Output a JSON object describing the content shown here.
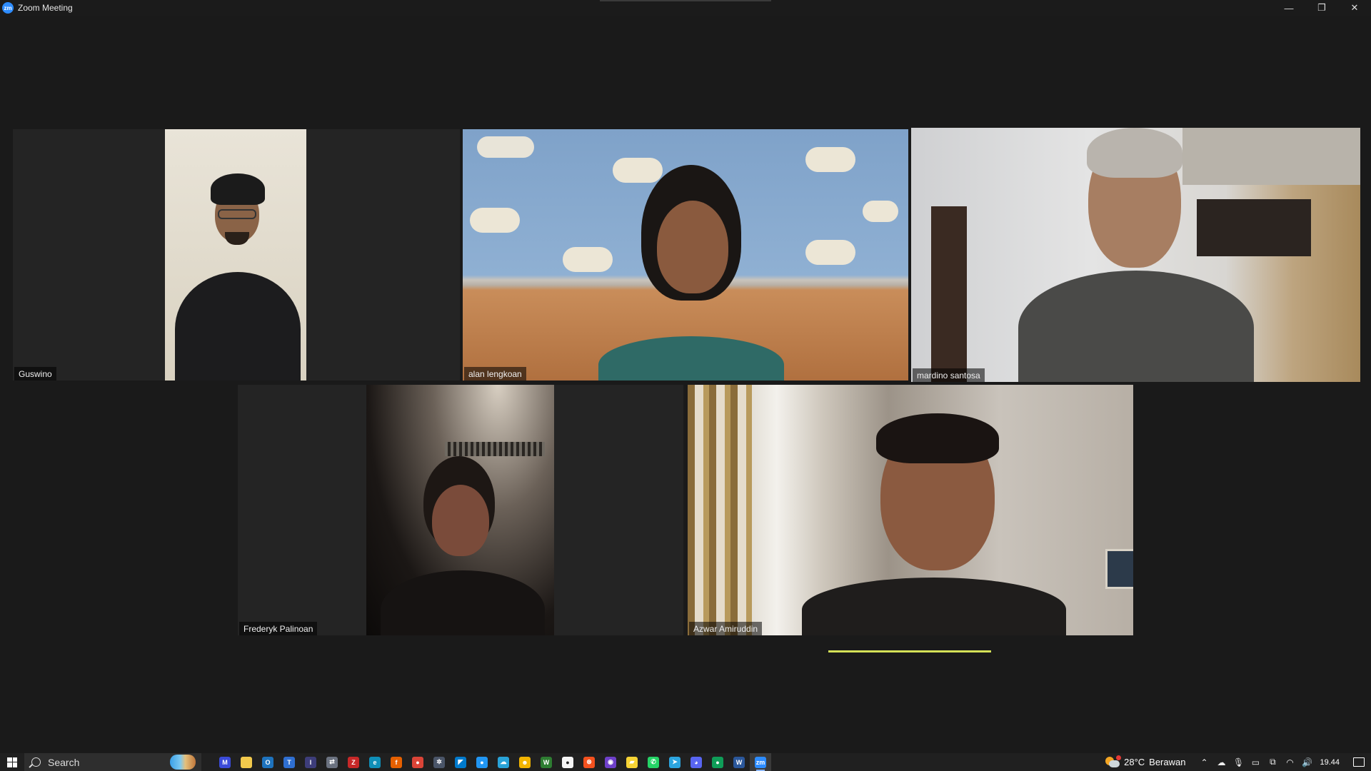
{
  "window": {
    "title": "Zoom Meeting",
    "logo_text": "zm",
    "minimize_label": "—",
    "restore_label": "❐",
    "close_label": "✕"
  },
  "participants": [
    {
      "name": "Guswino"
    },
    {
      "name": "alan lengkoan"
    },
    {
      "name": "mardino santosa",
      "active_speaker": true
    },
    {
      "name": "Frederyk Palinoan"
    },
    {
      "name": "Azwar Amiruddin",
      "speaking": true
    }
  ],
  "colors": {
    "active_border": "#d4e157",
    "tile_bg": "#242424",
    "meeting_bg": "#1a1a1a"
  },
  "taskbar": {
    "search_placeholder": "Search",
    "apps": [
      {
        "icon": "mail-app-icon",
        "color": "#3b4bd9",
        "glyph": "M"
      },
      {
        "icon": "file-explorer-icon",
        "color": "#f2c94c",
        "glyph": ""
      },
      {
        "icon": "outlook-icon",
        "color": "#1e73be",
        "glyph": "O"
      },
      {
        "icon": "trello-icon",
        "color": "#2f6fd1",
        "glyph": "T"
      },
      {
        "icon": "ide-icon",
        "color": "#3d3d7a",
        "glyph": "I"
      },
      {
        "icon": "remote-icon",
        "color": "#6b7280",
        "glyph": "⇄"
      },
      {
        "icon": "filezilla-icon",
        "color": "#c62828",
        "glyph": "Z"
      },
      {
        "icon": "edge-icon",
        "color": "#0f8fb8",
        "glyph": "e"
      },
      {
        "icon": "firefox-icon",
        "color": "#e66000",
        "glyph": "f"
      },
      {
        "icon": "chrome-icon",
        "color": "#db4437",
        "glyph": "●"
      },
      {
        "icon": "chrome-alt-icon",
        "color": "#4a5568",
        "glyph": "✲"
      },
      {
        "icon": "vscode-icon",
        "color": "#007acc",
        "glyph": "◤"
      },
      {
        "icon": "app-blue-icon",
        "color": "#2196f3",
        "glyph": "●"
      },
      {
        "icon": "app-cloud-icon",
        "color": "#29a3d8",
        "glyph": "☁"
      },
      {
        "icon": "app-yellow-icon",
        "color": "#f2b400",
        "glyph": "☻"
      },
      {
        "icon": "app-green-icon",
        "color": "#2e7d32",
        "glyph": "W"
      },
      {
        "icon": "app-white-icon",
        "color": "#f5f5f5",
        "glyph": "●"
      },
      {
        "icon": "app-orange-icon",
        "color": "#f4511e",
        "glyph": "⊗"
      },
      {
        "icon": "github-icon",
        "color": "#6e40c9",
        "glyph": "◉"
      },
      {
        "icon": "sticky-notes-icon",
        "color": "#f6d335",
        "glyph": "▰"
      },
      {
        "icon": "whatsapp-icon",
        "color": "#25d366",
        "glyph": "✆"
      },
      {
        "icon": "telegram-icon",
        "color": "#2ca5e0",
        "glyph": "➤"
      },
      {
        "icon": "discord-icon",
        "color": "#5865f2",
        "glyph": "◕"
      },
      {
        "icon": "chrome-icon-2",
        "color": "#0f9d58",
        "glyph": "●"
      },
      {
        "icon": "word-icon",
        "color": "#2b579a",
        "glyph": "W"
      },
      {
        "icon": "zoom-icon",
        "color": "#2d8cff",
        "glyph": "zm"
      }
    ],
    "weather": {
      "temp": "28°C",
      "condition": "Berawan"
    },
    "tray_icons": [
      "chevron-up-icon",
      "onedrive-icon",
      "microphone-icon",
      "battery-icon",
      "device-icon",
      "wifi-icon",
      "volume-icon"
    ],
    "clock": "19.44"
  }
}
